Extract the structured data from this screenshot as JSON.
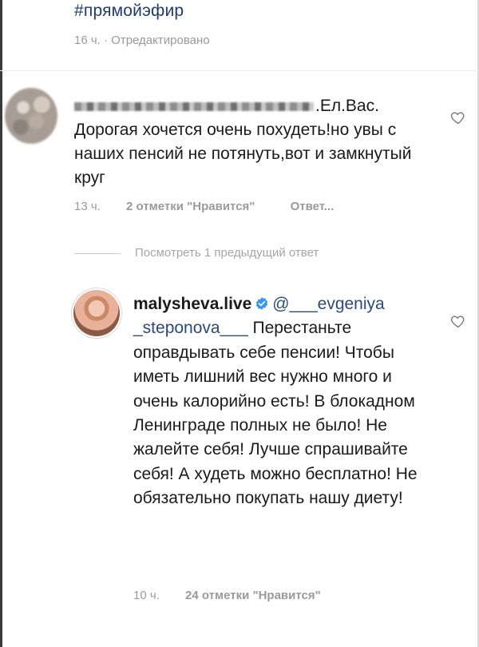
{
  "post": {
    "hashtag": "#прямойэфир",
    "meta": "16 ч. · Отредактировано"
  },
  "comment1": {
    "trailing_name": ".Ел.Вас.",
    "text": "Дорогая хочется очень похудеть!но увы с наших пенсий не потянуть,вот и замкнутый круг",
    "time": "13 ч.",
    "likes": "2 отметки \"Нравится\"",
    "reply": "Ответ..."
  },
  "view_previous": "Посмотреть 1 предыдущий ответ",
  "comment2": {
    "username": "malysheva.live",
    "mention": "@___evgeniya _steponova___",
    "text": "Перестаньте оправдывать себе пенсии! Чтобы иметь лишний вес нужно много и очень калорийно есть! В блокадном Ленинграде полных не было! Не жалейте себя! Лучше спрашивайте себя! А худеть можно бесплатно! Не обязательно покупать нашу диету!",
    "time": "10 ч.",
    "likes": "24 отметки \"Нравится\""
  },
  "icons": {
    "like": "heart-outline-icon",
    "verified": "verified-badge-icon"
  },
  "colors": {
    "verified": "#3897f0",
    "mention": "#2b4a7c",
    "meta": "#9a9a9a"
  }
}
